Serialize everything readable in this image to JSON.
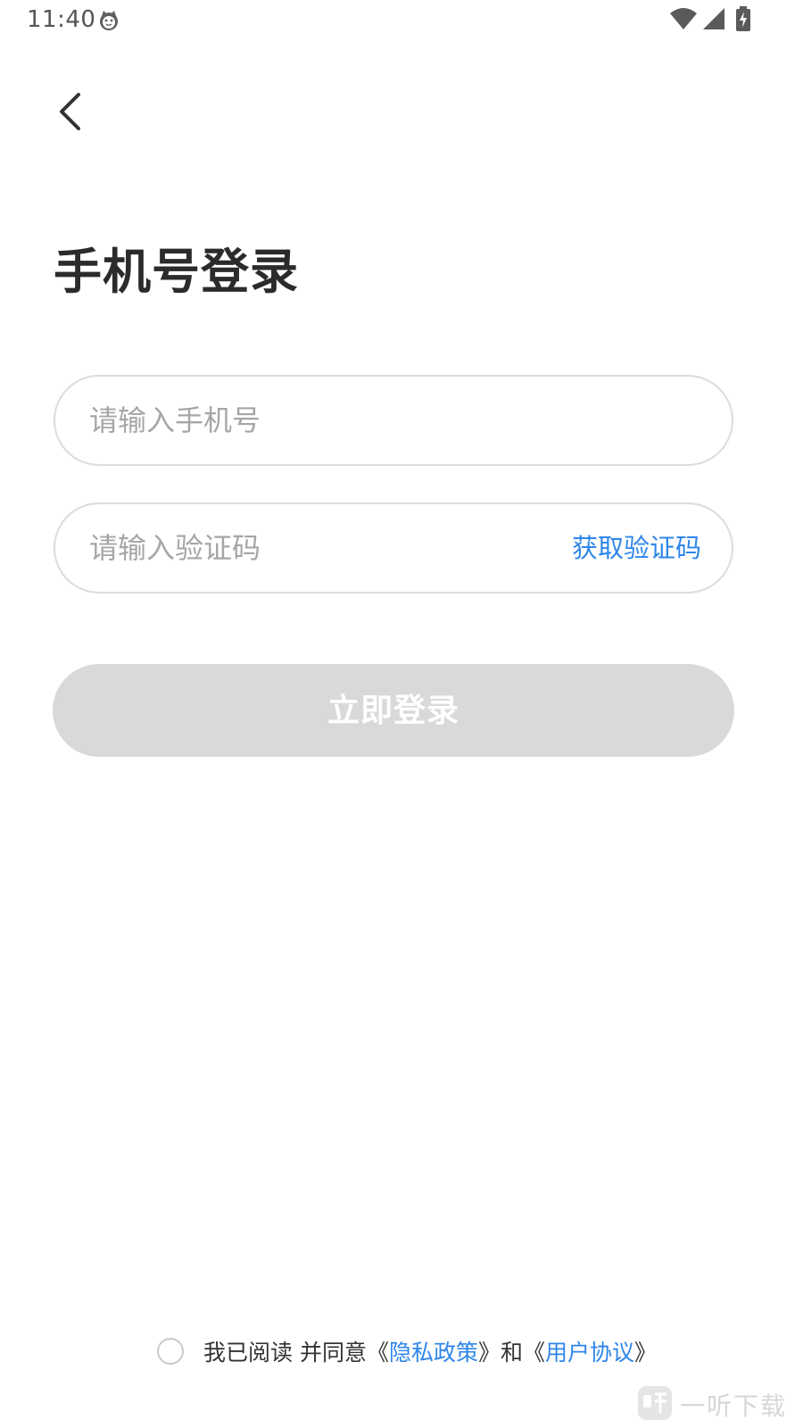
{
  "status_bar": {
    "time": "11:40",
    "icons": [
      "cat-app-icon",
      "wifi-icon",
      "cell-signal-icon",
      "battery-charging-icon"
    ]
  },
  "header": {
    "back_icon": "chevron-left-icon"
  },
  "title": "手机号登录",
  "phone_field": {
    "placeholder": "请输入手机号",
    "value": ""
  },
  "code_field": {
    "placeholder": "请输入验证码",
    "value": "",
    "get_code_label": "获取验证码"
  },
  "login_button": {
    "label": "立即登录",
    "enabled": false
  },
  "agreement": {
    "checked": false,
    "prefix": "我已阅读 并同意《",
    "privacy_link": "隐私政策",
    "middle": "》和《",
    "terms_link": "用户协议",
    "suffix": "》"
  },
  "watermark": {
    "text": "一听下载"
  },
  "colors": {
    "accent": "#2f86ea",
    "button_disabled": "#d9d9d9",
    "title": "#2b2b2b",
    "border": "#dcdcdc",
    "placeholder": "#a6a6a6"
  }
}
